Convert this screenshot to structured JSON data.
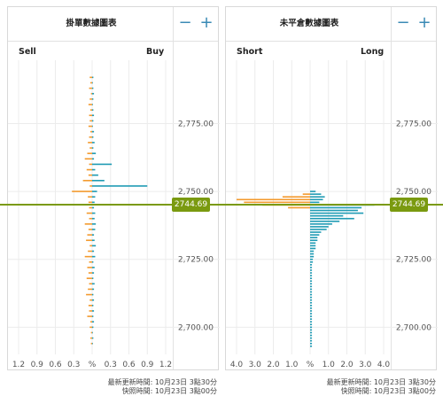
{
  "colors": {
    "buy": "#1f9bb4",
    "sell": "#f39a2e",
    "price": "#7a9a10",
    "accent": "#3a8ab5"
  },
  "left": {
    "title": "掛單數據圖表",
    "zoom_out": "−",
    "zoom_in": "+",
    "left_label": "Sell",
    "right_label": "Buy",
    "x_ticks": [
      "1.2",
      "0.9",
      "0.6",
      "0.3",
      "%",
      "0.3",
      "0.6",
      "0.9",
      "1.2"
    ],
    "y_ticks": [
      "2,775.00",
      "2,750.00",
      "2,725.00",
      "2,700.00"
    ],
    "current_price": "2744.69",
    "footer_line1": "最新更新時間: 10月23日 3點30分",
    "footer_line2": "快照時間: 10月23日 3點00分"
  },
  "right": {
    "title": "未平倉數據圖表",
    "zoom_out": "−",
    "zoom_in": "+",
    "left_label": "Short",
    "right_label": "Long",
    "x_ticks": [
      "4.0",
      "3.0",
      "2.0",
      "1.0",
      "%",
      "1.0",
      "2.0",
      "3.0",
      "4.0"
    ],
    "y_ticks": [
      "2,775.00",
      "2,750.00",
      "2,725.00",
      "2,700.00"
    ],
    "current_price": "2744.69",
    "footer_line1": "最新更新時間: 10月23日 3點30分",
    "footer_line2": "快照時間: 10月23日 3點00分"
  },
  "chart_data": [
    {
      "type": "bar",
      "title": "掛單數據圖表",
      "orientation": "horizontal",
      "price_range": [
        2690,
        2797
      ],
      "x_range_percent": [
        -1.2,
        1.2
      ],
      "current_price": 2744.69,
      "series": [
        {
          "name": "Sell",
          "points": [
            [
              2792,
              0.04
            ],
            [
              2790,
              0.03
            ],
            [
              2788,
              0.05
            ],
            [
              2786,
              0.02
            ],
            [
              2784,
              0.04
            ],
            [
              2782,
              0.06
            ],
            [
              2780,
              0.03
            ],
            [
              2778,
              0.05
            ],
            [
              2776,
              0.04
            ],
            [
              2774,
              0.06
            ],
            [
              2772,
              0.03
            ],
            [
              2770,
              0.05
            ],
            [
              2768,
              0.07
            ],
            [
              2766,
              0.04
            ],
            [
              2764,
              0.08
            ],
            [
              2762,
              0.12
            ],
            [
              2760,
              0.05
            ],
            [
              2758,
              0.09
            ],
            [
              2756,
              0.06
            ],
            [
              2754,
              0.15
            ],
            [
              2752,
              0.04
            ],
            [
              2750,
              0.33
            ],
            [
              2748,
              0.07
            ],
            [
              2746,
              0.06
            ],
            [
              2744,
              0.05
            ],
            [
              2742,
              0.09
            ],
            [
              2740,
              0.05
            ],
            [
              2738,
              0.12
            ],
            [
              2736,
              0.06
            ],
            [
              2734,
              0.08
            ],
            [
              2732,
              0.1
            ],
            [
              2730,
              0.04
            ],
            [
              2728,
              0.07
            ],
            [
              2726,
              0.12
            ],
            [
              2724,
              0.05
            ],
            [
              2722,
              0.08
            ],
            [
              2720,
              0.06
            ],
            [
              2718,
              0.09
            ],
            [
              2716,
              0.05
            ],
            [
              2714,
              0.07
            ],
            [
              2712,
              0.1
            ],
            [
              2710,
              0.04
            ],
            [
              2708,
              0.06
            ],
            [
              2706,
              0.05
            ],
            [
              2704,
              0.08
            ],
            [
              2702,
              0.03
            ],
            [
              2700,
              0.04
            ],
            [
              2698,
              0.02
            ],
            [
              2696,
              0.03
            ],
            [
              2694,
              0.02
            ]
          ]
        },
        {
          "name": "Buy",
          "points": [
            [
              2792,
              0.02
            ],
            [
              2790,
              0.01
            ],
            [
              2788,
              0.02
            ],
            [
              2786,
              0.03
            ],
            [
              2784,
              0.02
            ],
            [
              2782,
              0.01
            ],
            [
              2780,
              0.02
            ],
            [
              2778,
              0.03
            ],
            [
              2776,
              0.02
            ],
            [
              2774,
              0.01
            ],
            [
              2772,
              0.03
            ],
            [
              2770,
              0.02
            ],
            [
              2768,
              0.04
            ],
            [
              2766,
              0.02
            ],
            [
              2764,
              0.06
            ],
            [
              2762,
              0.03
            ],
            [
              2760,
              0.32
            ],
            [
              2758,
              0.05
            ],
            [
              2756,
              0.1
            ],
            [
              2754,
              0.2
            ],
            [
              2752,
              0.9
            ],
            [
              2750,
              0.08
            ],
            [
              2748,
              0.05
            ],
            [
              2746,
              0.04
            ],
            [
              2744,
              0.03
            ],
            [
              2742,
              0.05
            ],
            [
              2740,
              0.04
            ],
            [
              2738,
              0.06
            ],
            [
              2736,
              0.05
            ],
            [
              2734,
              0.03
            ],
            [
              2732,
              0.04
            ],
            [
              2730,
              0.06
            ],
            [
              2728,
              0.03
            ],
            [
              2726,
              0.05
            ],
            [
              2724,
              0.02
            ],
            [
              2722,
              0.04
            ],
            [
              2720,
              0.03
            ],
            [
              2718,
              0.02
            ],
            [
              2716,
              0.04
            ],
            [
              2714,
              0.03
            ],
            [
              2712,
              0.02
            ],
            [
              2710,
              0.03
            ],
            [
              2708,
              0.02
            ],
            [
              2706,
              0.03
            ],
            [
              2704,
              0.02
            ],
            [
              2702,
              0.03
            ],
            [
              2700,
              0.02
            ],
            [
              2698,
              0.01
            ],
            [
              2696,
              0.02
            ],
            [
              2694,
              0.01
            ]
          ]
        }
      ]
    },
    {
      "type": "bar",
      "title": "未平倉數據圖表",
      "orientation": "horizontal",
      "price_range": [
        2690,
        2797
      ],
      "x_range_percent": [
        -4.0,
        4.0
      ],
      "current_price": 2744.69,
      "series": [
        {
          "name": "Short",
          "points": [
            [
              2749,
              0.4
            ],
            [
              2748,
              1.5
            ],
            [
              2747,
              4.0
            ],
            [
              2746,
              3.6
            ],
            [
              2745,
              2.6
            ],
            [
              2744,
              1.2
            ]
          ]
        },
        {
          "name": "Long",
          "points": [
            [
              2750,
              0.3
            ],
            [
              2749,
              0.6
            ],
            [
              2748,
              0.8
            ],
            [
              2747,
              0.7
            ],
            [
              2746,
              0.5
            ],
            [
              2745,
              3.5
            ],
            [
              2744,
              2.8
            ],
            [
              2743,
              2.6
            ],
            [
              2742,
              2.9
            ],
            [
              2741,
              1.8
            ],
            [
              2740,
              2.4
            ],
            [
              2739,
              1.6
            ],
            [
              2738,
              1.2
            ],
            [
              2737,
              1.0
            ],
            [
              2736,
              0.9
            ],
            [
              2735,
              0.6
            ],
            [
              2734,
              0.5
            ],
            [
              2733,
              0.4
            ],
            [
              2732,
              0.4
            ],
            [
              2731,
              0.3
            ],
            [
              2730,
              0.3
            ],
            [
              2729,
              0.3
            ],
            [
              2728,
              0.2
            ],
            [
              2727,
              0.2
            ],
            [
              2726,
              0.2
            ],
            [
              2725,
              0.15
            ],
            [
              2724,
              0.15
            ],
            [
              2723,
              0.1
            ],
            [
              2722,
              0.1
            ],
            [
              2721,
              0.1
            ],
            [
              2720,
              0.1
            ],
            [
              2719,
              0.1
            ],
            [
              2718,
              0.1
            ],
            [
              2717,
              0.1
            ],
            [
              2716,
              0.1
            ],
            [
              2715,
              0.1
            ],
            [
              2714,
              0.1
            ],
            [
              2713,
              0.1
            ],
            [
              2712,
              0.1
            ],
            [
              2711,
              0.1
            ],
            [
              2710,
              0.1
            ],
            [
              2709,
              0.1
            ],
            [
              2708,
              0.1
            ],
            [
              2707,
              0.1
            ],
            [
              2706,
              0.1
            ],
            [
              2705,
              0.1
            ],
            [
              2704,
              0.1
            ],
            [
              2703,
              0.1
            ],
            [
              2702,
              0.1
            ],
            [
              2701,
              0.1
            ],
            [
              2700,
              0.1
            ],
            [
              2699,
              0.1
            ],
            [
              2698,
              0.1
            ],
            [
              2697,
              0.1
            ],
            [
              2696,
              0.1
            ],
            [
              2695,
              0.1
            ],
            [
              2694,
              0.1
            ],
            [
              2693,
              0.1
            ]
          ]
        }
      ]
    }
  ]
}
